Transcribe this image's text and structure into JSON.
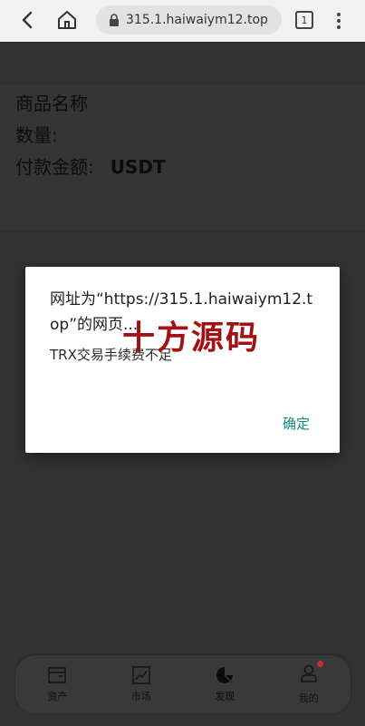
{
  "browser": {
    "url": "315.1.haiwaiym12.top",
    "tab_count": "1",
    "icons": [
      "back-arrow-icon",
      "home-icon",
      "lock-icon",
      "tab-switcher-icon",
      "more-vert-icon"
    ]
  },
  "order": {
    "product_label": "商品名称",
    "quantity_label": "数量:",
    "amount_label": "付款金额:",
    "amount_currency": "USDT"
  },
  "dialog": {
    "title": "网址为“https://315.1.haiwaiym12.top”的网页...",
    "message": "TRX交易手续费不足",
    "ok_label": "确定",
    "accent_color": "#148a7a"
  },
  "watermark": {
    "text": "十方源码",
    "color": "#a31212"
  },
  "bottom_nav": {
    "items": [
      {
        "label": "资产",
        "icon": "wallet-icon"
      },
      {
        "label": "市场",
        "icon": "chart-icon"
      },
      {
        "label": "发现",
        "icon": "discover-icon"
      },
      {
        "label": "我的",
        "icon": "user-icon"
      }
    ]
  }
}
